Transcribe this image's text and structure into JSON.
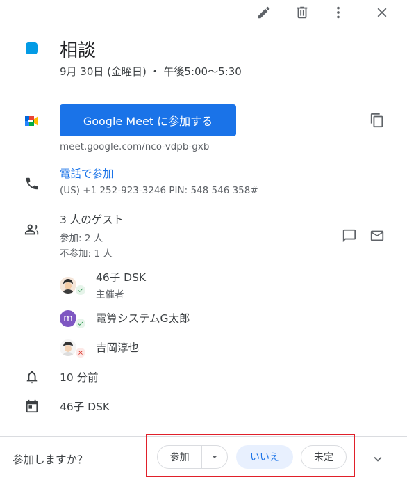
{
  "toolbar": {
    "edit_icon": "edit-icon",
    "delete_icon": "delete-icon",
    "more_icon": "more-vert-icon",
    "close_icon": "close-icon"
  },
  "event": {
    "color": "#039be5",
    "title": "相談",
    "datetime": "9月 30日 (金曜日) ・ 午後5:00～5:30"
  },
  "meet": {
    "button_label": "Google Meet に参加する",
    "url": "meet.google.com/nco-vdpb-gxb"
  },
  "phone": {
    "link_label": "電話で参加",
    "details": "(US) +1 252-923-3246 PIN: 548 546 358#"
  },
  "guests": {
    "summary": "3 人のゲスト",
    "yes": "参加: 2 人",
    "no": "不参加: 1 人",
    "list": [
      {
        "name": "46子 DSK",
        "role": "主催者",
        "status": "yes"
      },
      {
        "name": "電算システムG太郎",
        "role": "",
        "status": "yes",
        "initial": "m"
      },
      {
        "name": "吉岡淳也",
        "role": "",
        "status": "no"
      }
    ]
  },
  "reminder": "10 分前",
  "calendar": "46子 DSK",
  "rsvp": {
    "question": "参加しますか？",
    "yes_label": "参加",
    "no_label": "いいえ",
    "maybe_label": "未定"
  },
  "colors": {
    "accent": "#1a73e8",
    "event": "#039be5",
    "yes_badge": "#34a853",
    "no_badge": "#ea4335",
    "selected_pill": "#e8f0fe",
    "highlight": "#e0202a"
  }
}
